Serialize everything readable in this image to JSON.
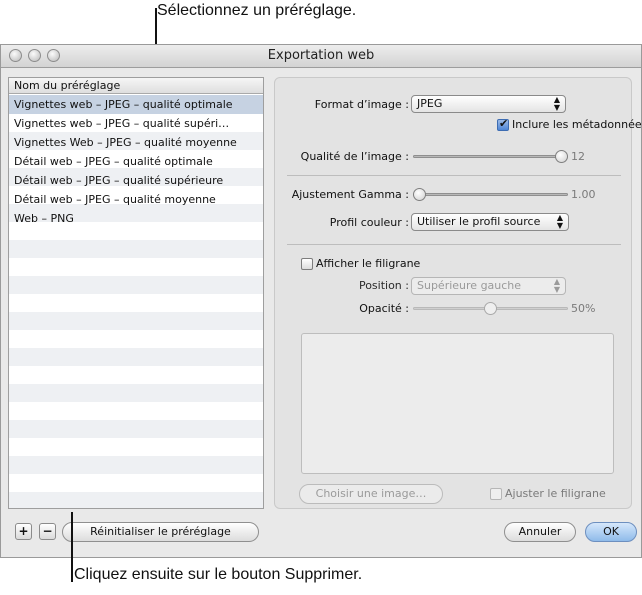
{
  "callouts": {
    "top": "Sélectionnez un préréglage.",
    "bottom": "Cliquez ensuite sur le bouton Supprimer."
  },
  "window": {
    "title": "Exportation web"
  },
  "presets": {
    "header": "Nom du préréglage",
    "items": [
      {
        "label": "Vignettes web – JPEG – qualité optimale",
        "selected": true
      },
      {
        "label": "Vignettes web – JPEG – qualité supéri…",
        "selected": false
      },
      {
        "label": "Vignettes Web – JPEG – qualité moyenne",
        "selected": false
      },
      {
        "label": "Détail web – JPEG – qualité optimale",
        "selected": false
      },
      {
        "label": "Détail web – JPEG – qualité supérieure",
        "selected": false
      },
      {
        "label": "Détail web – JPEG – qualité moyenne",
        "selected": false
      },
      {
        "label": "Web – PNG",
        "selected": false
      }
    ]
  },
  "settings": {
    "format_label": "Format d’image :",
    "format_value": "JPEG",
    "metadata_label": "Inclure les métadonnées",
    "metadata_checked": true,
    "quality_label": "Qualité de l’image :",
    "quality_value": "12",
    "quality_fraction": 1.0,
    "gamma_label": "Ajustement Gamma :",
    "gamma_value": "1.00",
    "gamma_fraction": 0.0,
    "profile_label": "Profil couleur :",
    "profile_value": "Utiliser le profil source",
    "watermark_label": "Afficher le filigrane",
    "watermark_checked": false,
    "position_label": "Position :",
    "position_value": "Supérieure gauche",
    "opacity_label": "Opacité :",
    "opacity_value": "50%",
    "opacity_fraction": 0.5,
    "choose_image_button": "Choisir une image…",
    "scale_watermark_label": "Ajuster le filigrane"
  },
  "footer": {
    "add_button": "+",
    "remove_button": "−",
    "reset_button": "Réinitialiser le préréglage",
    "cancel_button": "Annuler",
    "ok_button": "OK"
  }
}
